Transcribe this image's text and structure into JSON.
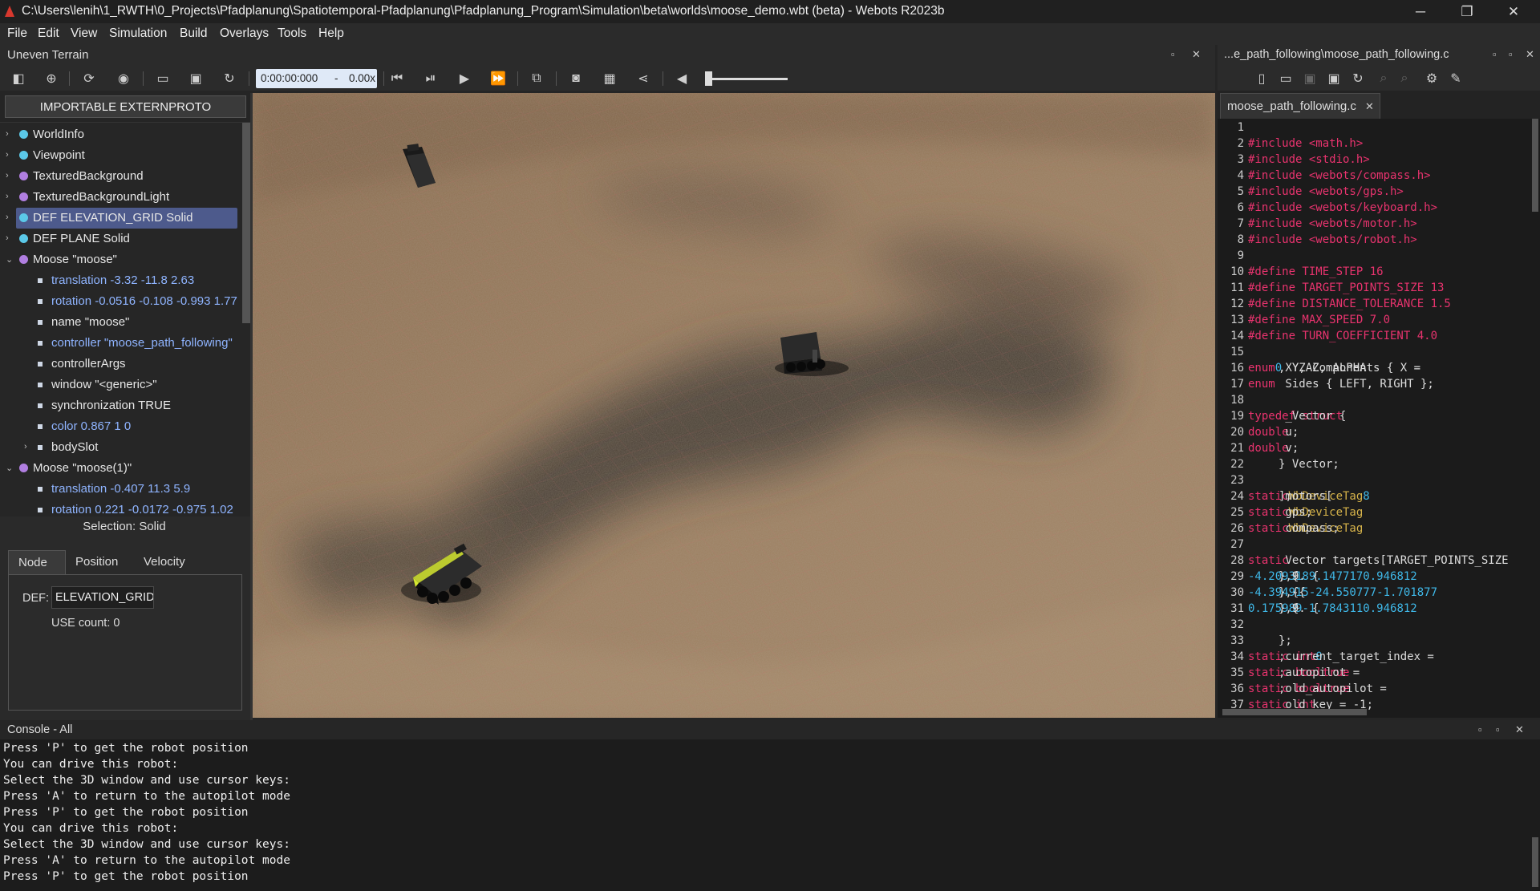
{
  "window": {
    "title": "C:\\Users\\lenih\\1_RWTH\\0_Projects\\Pfadplanung\\Spatiotemporal-Pfadplanung\\Pfadplanung_Program\\Simulation\\beta\\worlds\\moose_demo.wbt (beta) - Webots R2023b",
    "minimize_icon": "─",
    "restore_icon": "❐",
    "close_icon": "✕"
  },
  "menu": [
    "File",
    "Edit",
    "View",
    "Simulation",
    "Build",
    "Overlays",
    "Tools",
    "Help"
  ],
  "scene_panel": {
    "title": "Uneven Terrain"
  },
  "toolbar": {
    "time": "0:00:00:000",
    "speed_sep": "-",
    "speed": "0.00x"
  },
  "scene_tree": {
    "extern_button": "IMPORTABLE EXTERNPROTO",
    "items": [
      {
        "label": "WorldInfo",
        "kind": "node",
        "color": "#5bc8e8",
        "expanded": false
      },
      {
        "label": "Viewpoint",
        "kind": "node",
        "color": "#5bc8e8",
        "expanded": false
      },
      {
        "label": "TexturedBackground",
        "kind": "node",
        "color": "#b07ee0",
        "expanded": false
      },
      {
        "label": "TexturedBackgroundLight",
        "kind": "node",
        "color": "#b07ee0",
        "expanded": false
      },
      {
        "label": "DEF ELEVATION_GRID Solid",
        "kind": "node",
        "color": "#5bc8e8",
        "expanded": false,
        "selected": true
      },
      {
        "label": "DEF PLANE Solid",
        "kind": "node",
        "color": "#5bc8e8",
        "expanded": false
      },
      {
        "label": "Moose \"moose\"",
        "kind": "node",
        "color": "#b07ee0",
        "expanded": true
      },
      {
        "label": "translation -3.32 -11.8 2.63",
        "kind": "field",
        "changed": true
      },
      {
        "label": "rotation -0.0516 -0.108 -0.993 1.77",
        "kind": "field",
        "changed": true
      },
      {
        "label": "name \"moose\"",
        "kind": "field"
      },
      {
        "label": "controller \"moose_path_following\"",
        "kind": "field",
        "changed": true
      },
      {
        "label": "controllerArgs",
        "kind": "field"
      },
      {
        "label": "window \"<generic>\"",
        "kind": "field"
      },
      {
        "label": "synchronization TRUE",
        "kind": "field"
      },
      {
        "label": "color 0.867 1 0",
        "kind": "field",
        "changed": true
      },
      {
        "label": "bodySlot",
        "kind": "slot"
      },
      {
        "label": "Moose \"moose(1)\"",
        "kind": "node",
        "color": "#b07ee0",
        "expanded": true
      },
      {
        "label": "translation -0.407 11.3 5.9",
        "kind": "field",
        "changed": true
      },
      {
        "label": "rotation 0.221 -0.0172 -0.975 1.02",
        "kind": "field",
        "changed": true
      }
    ]
  },
  "selection": {
    "title": "Selection: Solid",
    "tabs": [
      "Node",
      "Position",
      "Velocity"
    ],
    "def_label": "DEF:",
    "def_value": "ELEVATION_GRID",
    "use_count": "USE count: 0"
  },
  "editor": {
    "path": "...e_path_following\\moose_path_following.c",
    "tab": "moose_path_following.c",
    "lines": [
      [],
      [
        [
          "pp",
          "#include <math.h>"
        ]
      ],
      [
        [
          "pp",
          "#include <stdio.h>"
        ]
      ],
      [
        [
          "pp",
          "#include <webots/compass.h>"
        ]
      ],
      [
        [
          "pp",
          "#include <webots/gps.h>"
        ]
      ],
      [
        [
          "pp",
          "#include <webots/keyboard.h>"
        ]
      ],
      [
        [
          "pp",
          "#include <webots/motor.h>"
        ]
      ],
      [
        [
          "pp",
          "#include <webots/robot.h>"
        ]
      ],
      [],
      [
        [
          "pp",
          "#define TIME_STEP 16"
        ]
      ],
      [
        [
          "pp",
          "#define TARGET_POINTS_SIZE 13"
        ]
      ],
      [
        [
          "pp",
          "#define DISTANCE_TOLERANCE 1.5"
        ]
      ],
      [
        [
          "pp",
          "#define MAX_SPEED 7.0"
        ]
      ],
      [
        [
          "pp",
          "#define TURN_COEFFICIENT 4.0"
        ]
      ],
      [],
      [
        [
          "kw",
          "enum"
        ],
        [
          "tx",
          " XYZAComponents { X = "
        ],
        [
          "nm",
          "0"
        ],
        [
          "tx",
          ", Y, Z, ALPHA"
        ]
      ],
      [
        [
          "kw",
          "enum"
        ],
        [
          "tx",
          " Sides { LEFT, RIGHT };"
        ]
      ],
      [],
      [
        [
          "kw",
          "typedef struct"
        ],
        [
          "tx",
          " _Vector {"
        ]
      ],
      [
        [
          "tx",
          "  "
        ],
        [
          "kw",
          "double"
        ],
        [
          "tx",
          " u;"
        ]
      ],
      [
        [
          "tx",
          "  "
        ],
        [
          "kw",
          "double"
        ],
        [
          "tx",
          " v;"
        ]
      ],
      [
        [
          "tx",
          "} Vector;"
        ]
      ],
      [],
      [
        [
          "kw",
          "static"
        ],
        [
          "tx",
          " "
        ],
        [
          "ty",
          "WbDeviceTag"
        ],
        [
          "tx",
          " motors["
        ],
        [
          "nm",
          "8"
        ],
        [
          "tx",
          "];"
        ]
      ],
      [
        [
          "kw",
          "static"
        ],
        [
          "tx",
          " "
        ],
        [
          "ty",
          "WbDeviceTag"
        ],
        [
          "tx",
          " gps;"
        ]
      ],
      [
        [
          "kw",
          "static"
        ],
        [
          "tx",
          " "
        ],
        [
          "ty",
          "WbDeviceTag"
        ],
        [
          "tx",
          " compass;"
        ]
      ],
      [],
      [
        [
          "kw",
          "static"
        ],
        [
          "tx",
          " Vector targets[TARGET_POINTS_SIZE"
        ]
      ],
      [
        [
          "tx",
          "  {"
        ],
        [
          "nm",
          "-4.209318"
        ],
        [
          "tx",
          ", "
        ],
        [
          "nm",
          "9.147717"
        ],
        [
          "tx",
          "},   {"
        ],
        [
          "nm",
          "0.946812"
        ],
        [
          "tx",
          ", 9."
        ]
      ],
      [
        [
          "tx",
          "  {"
        ],
        [
          "nm",
          "-4.394915"
        ],
        [
          "tx",
          ", "
        ],
        [
          "nm",
          "-24.550777"
        ],
        [
          "tx",
          "}, {"
        ],
        [
          "nm",
          "-1.701877"
        ],
        [
          "tx",
          ", -"
        ]
      ],
      [
        [
          "tx",
          "  {"
        ],
        [
          "nm",
          "0.175989"
        ],
        [
          "tx",
          ", "
        ],
        [
          "nm",
          "-1.784311"
        ],
        [
          "tx",
          "},   {"
        ],
        [
          "nm",
          "0.946812"
        ],
        [
          "tx",
          ", 9."
        ]
      ],
      [],
      [
        [
          "tx",
          "};"
        ]
      ],
      [
        [
          "kw",
          "static int"
        ],
        [
          "tx",
          " current_target_index = "
        ],
        [
          "nm",
          "0"
        ],
        [
          "tx",
          ";"
        ]
      ],
      [
        [
          "kw",
          "static bool"
        ],
        [
          "tx",
          " autopilot = "
        ],
        [
          "bl",
          "true"
        ],
        [
          "tx",
          ";"
        ]
      ],
      [
        [
          "kw",
          "static bool"
        ],
        [
          "tx",
          " old_autopilot = "
        ],
        [
          "bl",
          "true"
        ],
        [
          "tx",
          ";"
        ]
      ],
      [
        [
          "kw",
          "static int"
        ],
        [
          "tx",
          " old_key = -1;"
        ]
      ]
    ]
  },
  "console": {
    "title": "Console - All",
    "lines": [
      "Press 'P' to get the robot position",
      "You can drive this robot:",
      "Select the 3D window and use cursor keys:",
      "Press 'A' to return to the autopilot mode",
      "Press 'P' to get the robot position",
      "You can drive this robot:",
      "Select the 3D window and use cursor keys:",
      "Press 'A' to return to the autopilot mode",
      "Press 'P' to get the robot position"
    ]
  },
  "colors": {
    "selection": "#4d5a8c",
    "changed_field": "#8fb4ff",
    "accent": "#e8336e"
  },
  "icons": {
    "panel_float": "▫",
    "panel_close": "✕",
    "tab_close": "✕"
  }
}
